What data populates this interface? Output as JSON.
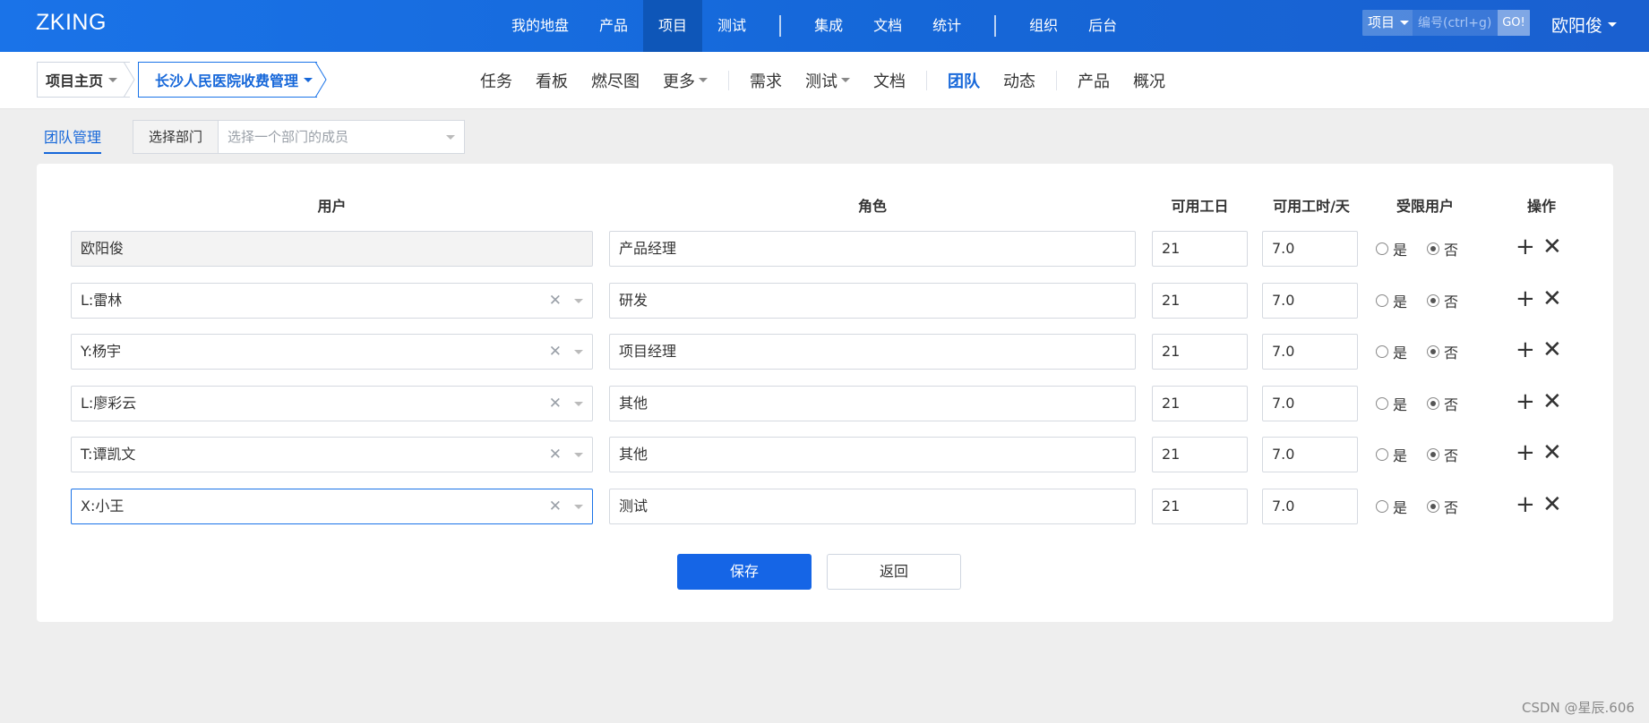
{
  "app": {
    "logo": "ZKING"
  },
  "topnav": {
    "items": [
      "我的地盘",
      "产品",
      "项目",
      "测试",
      "集成",
      "文档",
      "统计",
      "组织",
      "后台"
    ],
    "active": "项目"
  },
  "search": {
    "type": "项目",
    "placeholder": "编号(ctrl+g)",
    "go": "GO!"
  },
  "user": {
    "name": "欧阳俊"
  },
  "breadcrumb": {
    "home": "项目主页",
    "project": "长沙人民医院收费管理"
  },
  "subnav": {
    "items": [
      "任务",
      "看板",
      "燃尽图",
      "更多",
      "需求",
      "测试",
      "文档",
      "团队",
      "动态",
      "产品",
      "概况"
    ],
    "active": "团队"
  },
  "team": {
    "title": "团队管理",
    "dept_label": "选择部门",
    "dept_placeholder": "选择一个部门的成员"
  },
  "table": {
    "headers": {
      "user": "用户",
      "role": "角色",
      "days": "可用工日",
      "hours": "可用工时/天",
      "limited": "受限用户",
      "actions": "操作"
    },
    "yes": "是",
    "no": "否",
    "rows": [
      {
        "user": "欧阳俊",
        "role": "产品经理",
        "days": "21",
        "hours": "7.0",
        "limited": false
      },
      {
        "user": "L:雷林",
        "role": "研发",
        "days": "21",
        "hours": "7.0",
        "limited": false
      },
      {
        "user": "Y:杨宇",
        "role": "项目经理",
        "days": "21",
        "hours": "7.0",
        "limited": false
      },
      {
        "user": "L:廖彩云",
        "role": "其他",
        "days": "21",
        "hours": "7.0",
        "limited": false
      },
      {
        "user": "T:谭凯文",
        "role": "其他",
        "days": "21",
        "hours": "7.0",
        "limited": false
      },
      {
        "user": "X:小王",
        "role": "测试",
        "days": "21",
        "hours": "7.0",
        "limited": false
      }
    ]
  },
  "buttons": {
    "save": "保存",
    "back": "返回"
  },
  "watermark": "CSDN @星辰.606",
  "colors": {
    "brand": "#1a73e8",
    "active_nav": "#0e56b8",
    "page_bg": "#eeeeee"
  }
}
